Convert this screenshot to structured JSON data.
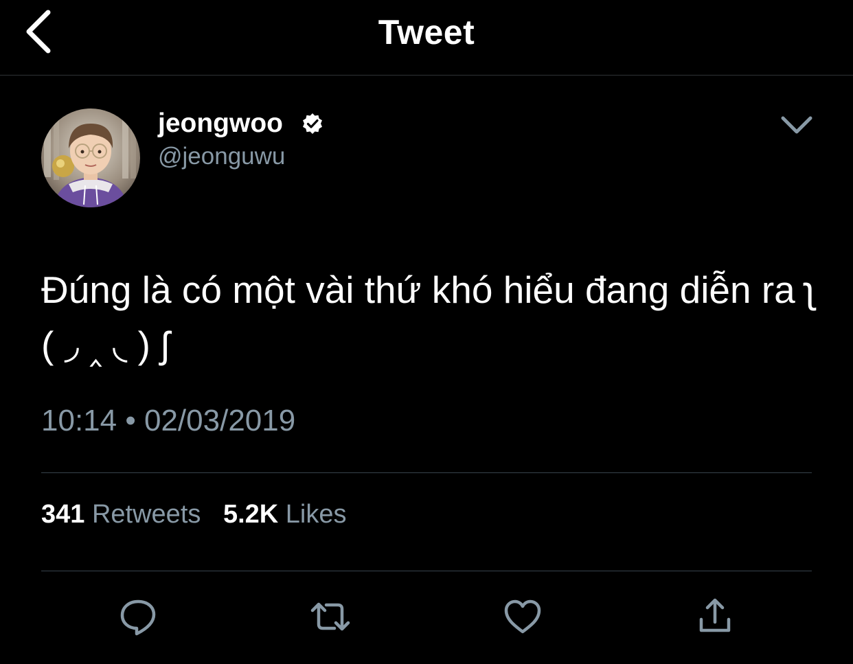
{
  "header": {
    "title": "Tweet"
  },
  "author": {
    "display_name": "jeongwoo",
    "handle": "@jeonguwu",
    "verified": true
  },
  "tweet": {
    "text": "Đúng là có một vài thứ khó hiểu đang diễn ra ʅ ( ◞ ‸ ◟ ) ʃ",
    "time": "10:14",
    "separator": "•",
    "date": "02/03/2019"
  },
  "stats": {
    "retweets_count": "341",
    "retweets_label": "Retweets",
    "likes_count": "5.2K",
    "likes_label": "Likes"
  },
  "actions": [
    "reply-icon",
    "retweet-icon",
    "like-icon",
    "share-icon"
  ],
  "colors": {
    "background": "#000000",
    "text": "#ffffff",
    "secondary_text": "#8899a6",
    "divider": "#38444d"
  }
}
